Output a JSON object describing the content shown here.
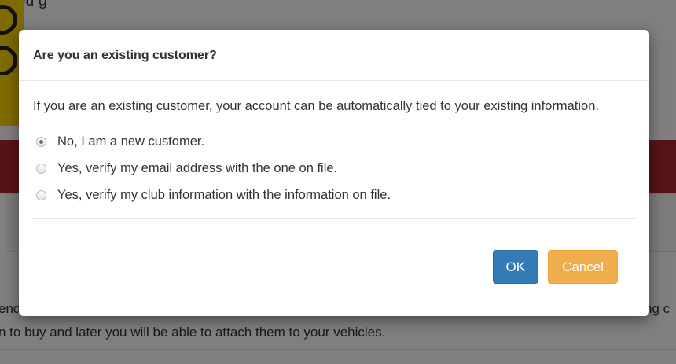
{
  "background": {
    "top_text": ", you                                        g",
    "lower_text_line1_left": "end",
    "lower_text_line1_right": "ng c",
    "lower_text_line2": "n to buy and later you will be able to attach them to your vehicles."
  },
  "dialog": {
    "title": "Are you an existing customer?",
    "message": "If you are an existing customer, your account can be automatically tied to your existing information.",
    "options": [
      {
        "label": "No, I am a new customer.",
        "selected": true
      },
      {
        "label": "Yes, verify my email address with the one on file.",
        "selected": false
      },
      {
        "label": "Yes, verify my club information with the information on file.",
        "selected": false
      }
    ],
    "ok_label": "OK",
    "cancel_label": "Cancel"
  },
  "colors": {
    "primary_button": "#337ab7",
    "warning_button": "#f0ad4e",
    "background_band": "#b0262c",
    "logo_yellow": "#ffd400"
  }
}
